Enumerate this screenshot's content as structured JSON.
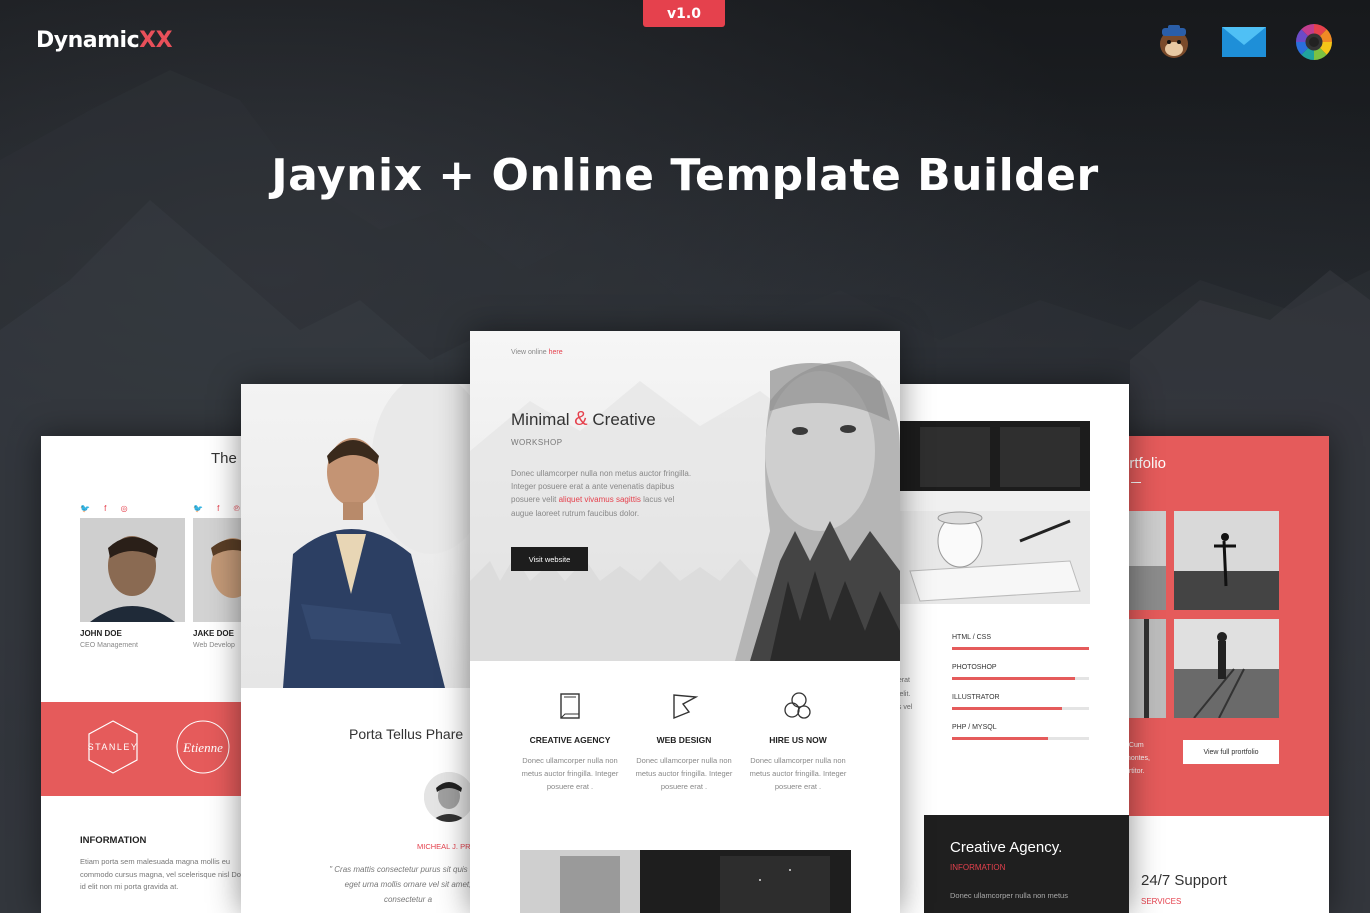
{
  "brand": {
    "name": "Dynamic",
    "suffix": "XX",
    "accent": "#e5414d"
  },
  "version": "v1.0",
  "headline": "Jaynix + Online Template Builder",
  "top_icons": [
    "mailchimp-icon",
    "campaign-monitor-icon",
    "color-wheel-icon"
  ],
  "card_team": {
    "title": "The",
    "members": [
      {
        "name": "JOHN DOE",
        "role": "CEO Management"
      },
      {
        "name": "JAKE DOE",
        "role": "Web Develop"
      }
    ],
    "logos": [
      "STANLEY",
      "Etienne"
    ],
    "info_heading": "INFORMATION",
    "info_text": "Etiam porta sem malesuada magna mollis eu commodo cursus magna, vel scelerisque nisl Donec id elit non mi porta gravida at."
  },
  "card_profile": {
    "title": "Porta Tellus Phare",
    "signature": "MICHEAL J. PR",
    "quote": "\" Cras mattis consectetur purus sit quis risus eget urna mollis ornare vel sit amet, consectetur a"
  },
  "card_main": {
    "view_online": "View online",
    "view_online_link": "here",
    "title_a": "Minimal",
    "title_amp": "&",
    "title_b": "Creative",
    "subtitle": "WORKSHOP",
    "body_a": "Donec ullamcorper nulla non metus auctor fringilla. Integer posuere erat a ante venenatis dapibus posuere velit",
    "body_highlight": "aliquet vivamus sagittis",
    "body_b": "lacus vel augue laoreet rutrum faucibus dolor.",
    "button": "Visit website",
    "features": [
      {
        "icon": "document-icon",
        "title": "CREATIVE AGENCY",
        "text": "Donec ullamcorper nulla non metus auctor fringilla. Integer posuere erat ."
      },
      {
        "icon": "flag-icon",
        "title": "WEB DESIGN",
        "text": "Donec ullamcorper nulla non metus auctor fringilla. Integer posuere erat ."
      },
      {
        "icon": "bubbles-icon",
        "title": "HIRE US NOW",
        "text": "Donec ullamcorper nulla non metus auctor fringilla. Integer posuere erat ."
      }
    ]
  },
  "card_skills": {
    "edge_text": "ı erat\nc elit.\nus vel",
    "skills": [
      {
        "label": "HTML / CSS",
        "level": 1.0
      },
      {
        "label": "PHOTOSHOP",
        "level": 0.9
      },
      {
        "label": "ILLUSTRATOR",
        "level": 0.8
      },
      {
        "label": "PHP / MYSQL",
        "level": 0.7
      }
    ],
    "dark_title": "Creative Agency.",
    "dark_sub": "INFORMATION",
    "dark_text": "Donec ullamcorper nulla non metus"
  },
  "card_portfolio": {
    "title": "ortfolio",
    "text": ". Cum\nmontes,\nortitor.",
    "button": "View full prortfolio",
    "support": "24/7 Support",
    "services": "SERVICES"
  }
}
